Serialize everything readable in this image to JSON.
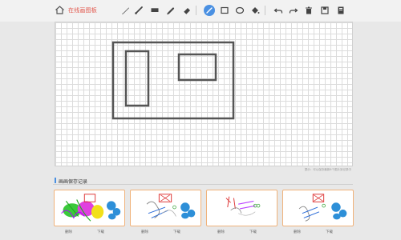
{
  "app": {
    "title": "在线画图板"
  },
  "toolbar": {
    "tools": [
      "pencil-tool",
      "brush-tool",
      "marker-tool",
      "spray-tool",
      "eraser-tool",
      "line-tool",
      "rectangle-tool",
      "ellipse-tool",
      "fill-tool",
      "undo",
      "redo",
      "clear",
      "save",
      "export"
    ],
    "active_tool": "line-tool",
    "accent_color": "#4a90e2"
  },
  "board": {
    "note": "提示：可以保存最新8个图片到记录中"
  },
  "records": {
    "title": "画画保存记录",
    "items": [
      {
        "delete_label": "删除",
        "download_label": "下载"
      },
      {
        "delete_label": "删除",
        "download_label": "下载"
      },
      {
        "delete_label": "删除",
        "download_label": "下载"
      },
      {
        "delete_label": "删除",
        "download_label": "下载"
      }
    ]
  }
}
